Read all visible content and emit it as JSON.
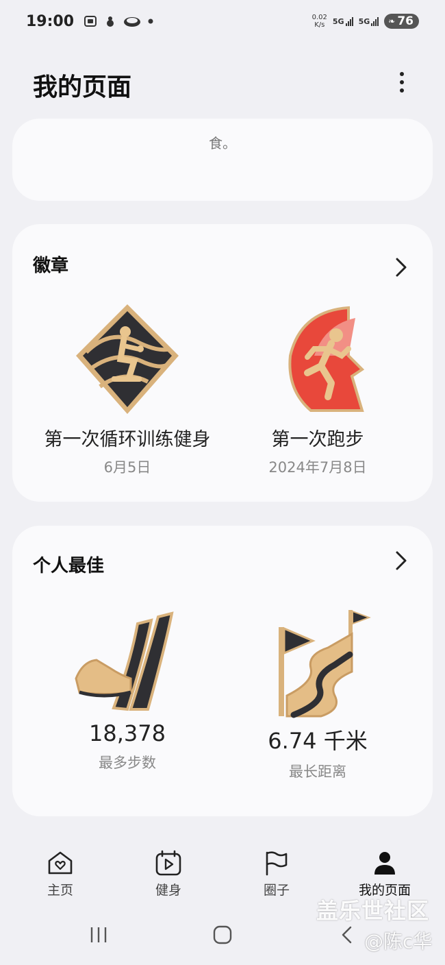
{
  "status_bar": {
    "time": "19:00",
    "net_speed_value": "0.02",
    "net_speed_unit": "K/s",
    "signal_1": "5G",
    "signal_2": "5G",
    "battery": "76",
    "icons": [
      "screenshot-icon",
      "squirrel-icon",
      "cloud-icon",
      "dot-icon"
    ]
  },
  "header": {
    "title": "我的页面"
  },
  "top_card": {
    "text": "食。"
  },
  "badges": {
    "title": "徽章",
    "items": [
      {
        "name": "第一次循环训练健身",
        "date": "6月5日",
        "icon": "circuit-training-badge"
      },
      {
        "name": "第一次跑步",
        "date": "2024年7月8日",
        "icon": "running-badge"
      }
    ]
  },
  "personal_best": {
    "title": "个人最佳",
    "items": [
      {
        "value": "18,378",
        "label": "最多步数",
        "icon": "shoe-badge"
      },
      {
        "value": "6.74 千米",
        "label": "最长距离",
        "icon": "flag-road-badge"
      }
    ]
  },
  "bottom_nav": {
    "items": [
      {
        "label": "主页",
        "icon": "home-heart-icon"
      },
      {
        "label": "健身",
        "icon": "fitness-calendar-icon"
      },
      {
        "label": "圈子",
        "icon": "flag-icon"
      },
      {
        "label": "我的页面",
        "icon": "person-icon",
        "active": true
      }
    ]
  },
  "watermark": {
    "site": "盖乐世社区",
    "user": "@陈c华"
  },
  "colors": {
    "background": "#f0f0f4",
    "card": "#fafafc",
    "badge_red": "#e8483b",
    "badge_gold": "#d9b27c",
    "badge_dark": "#2f2f33"
  }
}
